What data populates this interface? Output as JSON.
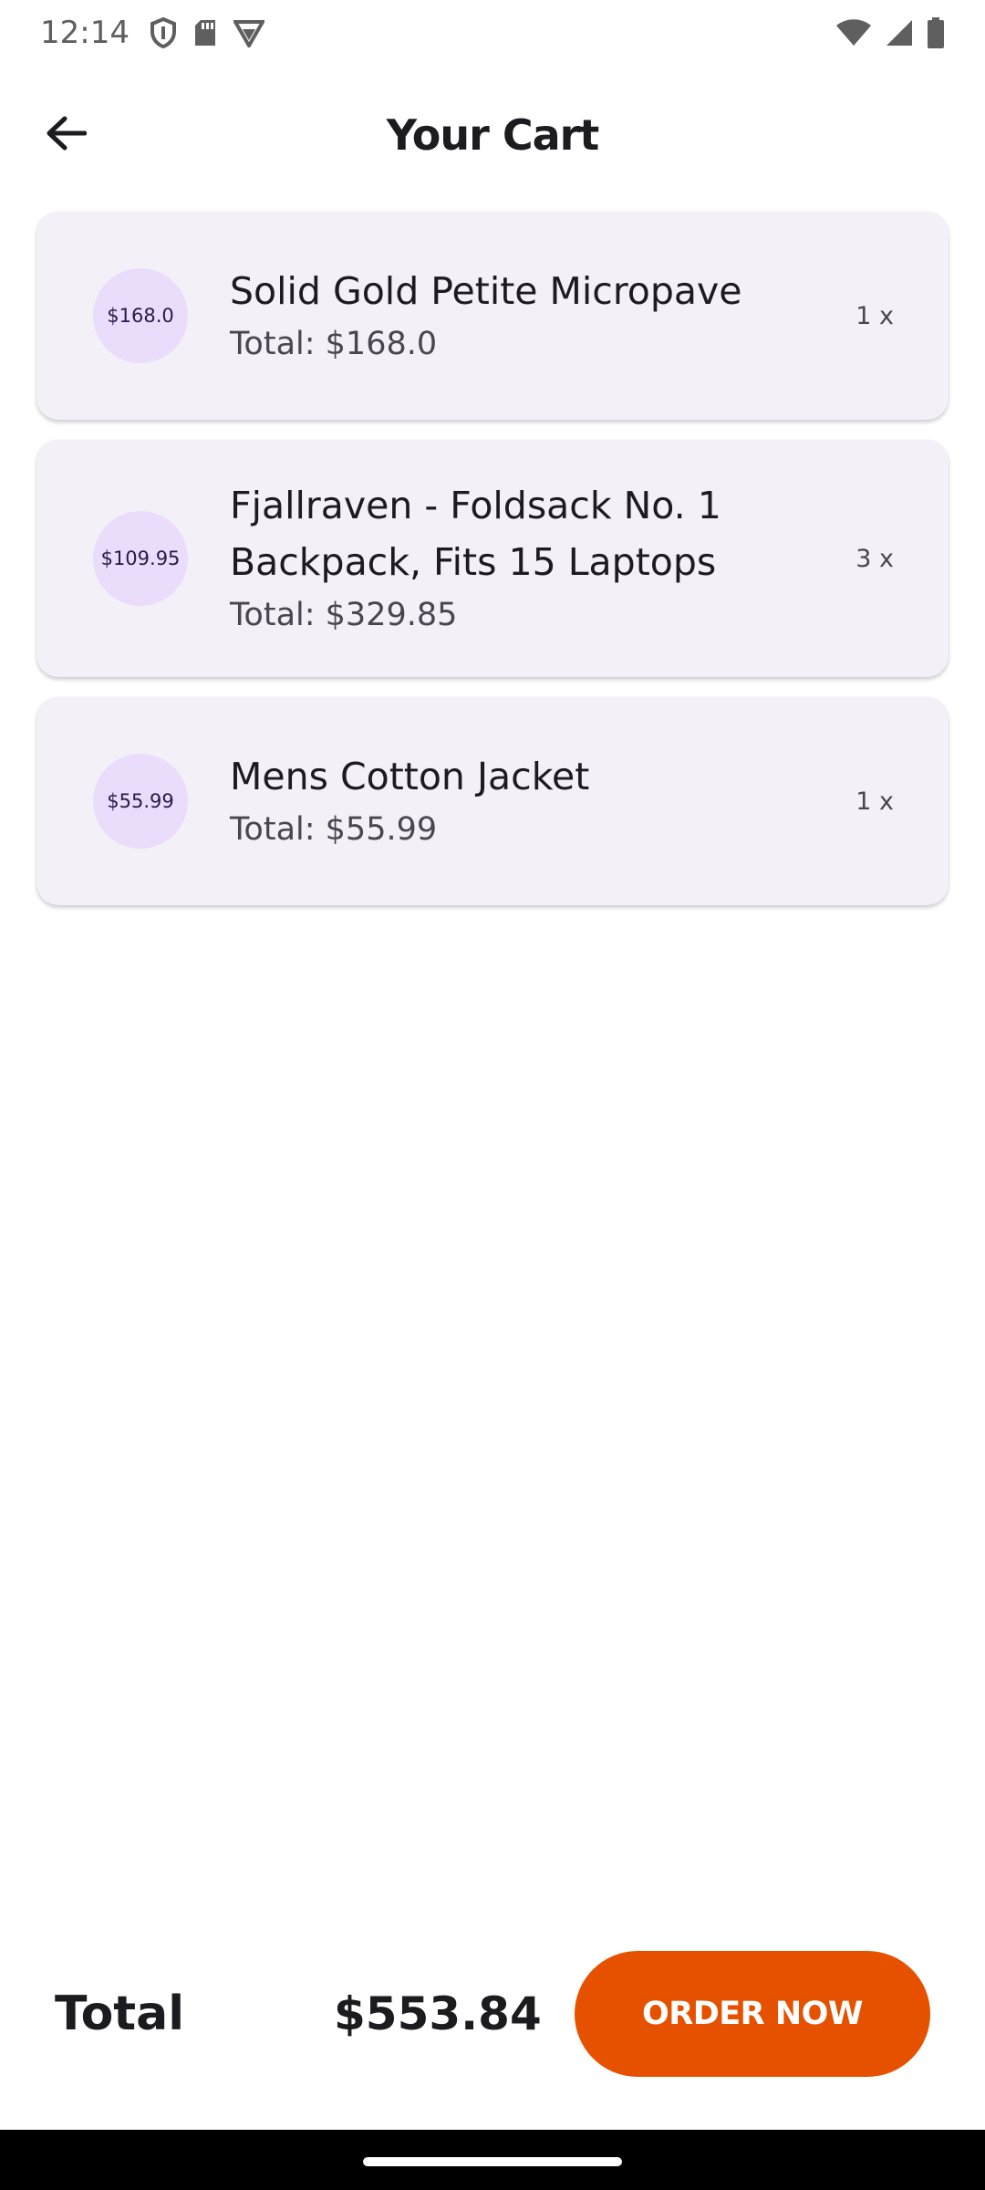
{
  "status_bar": {
    "time": "12:14",
    "left_icons": [
      "shield-icon",
      "sd-card-icon",
      "vpn-icon"
    ],
    "right_icons": [
      "wifi-icon",
      "signal-icon",
      "battery-icon"
    ]
  },
  "app_bar": {
    "title": "Your Cart",
    "back_icon": "arrow-back-icon"
  },
  "cart": {
    "items": [
      {
        "price_badge": "$168.0",
        "name": "Solid Gold Petite Micropave",
        "total": "Total: $168.0",
        "quantity": "1 x"
      },
      {
        "price_badge": "$109.95",
        "name": "Fjallraven - Foldsack No. 1 Backpack, Fits 15 Laptops",
        "total": "Total: $329.85",
        "quantity": "3 x"
      },
      {
        "price_badge": "$55.99",
        "name": "Mens Cotton Jacket",
        "total": "Total: $55.99",
        "quantity": "1 x"
      }
    ]
  },
  "footer": {
    "total_label": "Total",
    "total_amount": "$553.84",
    "order_button_label": "ORDER NOW"
  },
  "colors": {
    "accent": "#e65100",
    "card_background": "#f4f0f8",
    "avatar_background": "#eadcfb"
  }
}
